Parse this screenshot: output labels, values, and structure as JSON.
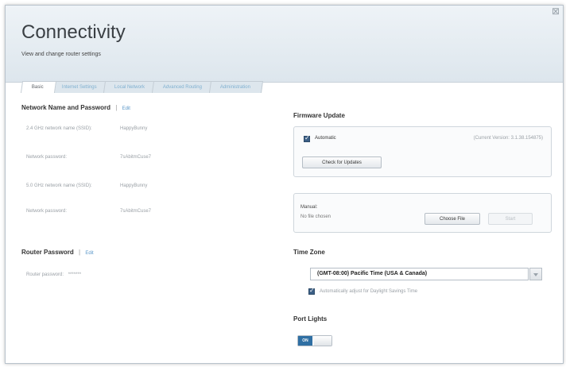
{
  "header": {
    "title": "Connectivity",
    "subtitle": "View and change router settings"
  },
  "tabs": [
    {
      "label": "Basic",
      "active": true
    },
    {
      "label": "Internet Settings",
      "active": false
    },
    {
      "label": "Local Network",
      "active": false
    },
    {
      "label": "Advanced Routing",
      "active": false
    },
    {
      "label": "Administration",
      "active": false
    }
  ],
  "network": {
    "title": "Network Name and Password",
    "separator": "|",
    "edit_label": "Edit",
    "rows": [
      {
        "label": "2.4 GHz network name (SSID):",
        "value": "HappyBunny"
      },
      {
        "label": "Network password:",
        "value": "7sAbitmCuse7"
      },
      {
        "label": "5.0 GHz network name (SSID):",
        "value": "HappyBunny"
      },
      {
        "label": "Network password:",
        "value": "7sAbitmCuse7"
      }
    ]
  },
  "router_password": {
    "title": "Router Password",
    "separator": "|",
    "edit_label": "Edit",
    "label": "Router password:",
    "value": "*******"
  },
  "firmware": {
    "title": "Firmware Update",
    "automatic_label": "Automatic",
    "automatic_checked": true,
    "current_version": "(Current Version: 3.1.38.154875)",
    "check_button": "Check for Updates",
    "manual_label": "Manual:",
    "file_status": "No file chosen",
    "choose_button": "Choose File",
    "start_button": "Start"
  },
  "timezone": {
    "title": "Time Zone",
    "selected": "(GMT-08:00) Pacific Time (USA & Canada)",
    "dst_label": "Automatically adjust for Daylight Savings Time",
    "dst_checked": true
  },
  "port_lights": {
    "title": "Port Lights",
    "state": "ON"
  },
  "colors": {
    "accent": "#2f6fa3",
    "link": "#5a97c8",
    "header_bg": "#dde6ed"
  }
}
